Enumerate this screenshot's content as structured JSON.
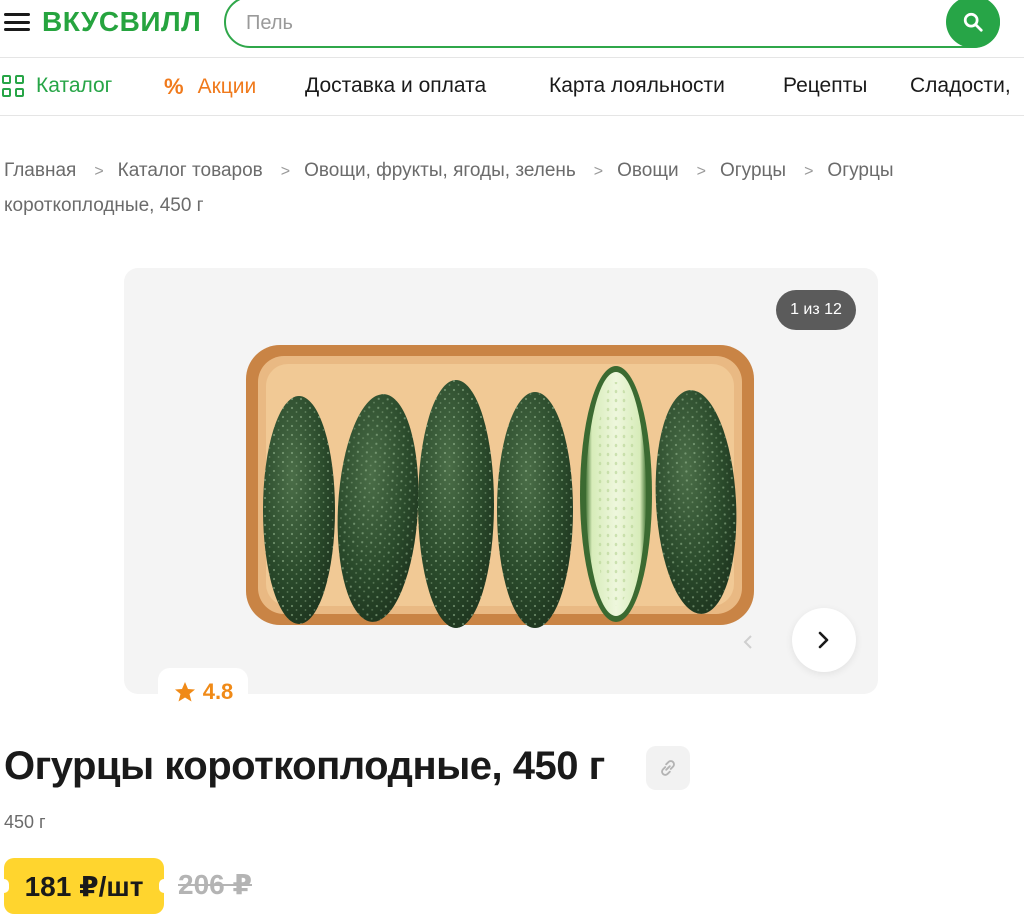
{
  "header": {
    "logo": "ВКУСВИЛЛ",
    "search_value": "",
    "search_placeholder": "Пель",
    "icons": {
      "menu": "burger-menu-icon",
      "search": "search-icon"
    }
  },
  "nav": {
    "items": [
      {
        "label": "Каталог",
        "icon": "grid-icon",
        "color": "#27a547"
      },
      {
        "label": "Акции",
        "icon": "percent-icon",
        "color": "#f07a1c"
      },
      {
        "label": "Доставка и оплата"
      },
      {
        "label": "Карта лояльности"
      },
      {
        "label": "Рецепты"
      },
      {
        "label": "Сладости,"
      }
    ]
  },
  "breadcrumb": [
    "Главная",
    "Каталог товаров",
    "Овощи, фрукты, ягоды, зелень",
    "Овощи",
    "Огурцы",
    "Огурцы короткоплодные, 450 г"
  ],
  "gallery": {
    "counter": "1 из 12",
    "current_image": 1,
    "total_images": 12
  },
  "product": {
    "rating": "4.8",
    "title": "Огурцы короткоплодные, 450 г",
    "weight": "450 г",
    "price": "181 ₽/шт",
    "old_price": "206 ₽"
  },
  "colors": {
    "brand_green": "#27a547",
    "sale_orange": "#f07a1c",
    "price_yellow": "#ffd52e",
    "rating_orange": "#f08a17"
  }
}
